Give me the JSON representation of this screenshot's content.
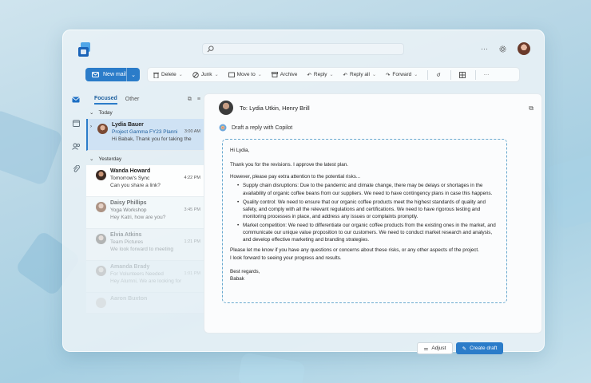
{
  "search": {
    "placeholder": ""
  },
  "header": {
    "more_label": "···"
  },
  "toolbar": {
    "new_mail": "New mail",
    "delete": "Delete",
    "junk": "Junk",
    "move_to": "Move to",
    "archive": "Archive",
    "reply": "Reply",
    "reply_all": "Reply all",
    "forward": "Forward",
    "more": "···"
  },
  "list": {
    "tab_focused": "Focused",
    "tab_other": "Other",
    "group_today": "Today",
    "group_yesterday": "Yesterday",
    "items": [
      {
        "name": "Lydia Bauer",
        "subject": "Project Gamma FY23 Planni",
        "time": "3:00 AM",
        "preview": "Hi Babak, Thank you for taking the"
      },
      {
        "name": "Wanda Howard",
        "subject": "Tomorrow's Sync",
        "time": "4:22 PM",
        "preview": "Can you share a link?"
      },
      {
        "name": "Daisy Phillips",
        "subject": "Yoga Workshop",
        "time": "3:45 PM",
        "preview": "Hey Katri, how are you?"
      },
      {
        "name": "Elvia Atkins",
        "subject": "Team Pictures",
        "time": "1:21 PM",
        "preview": "We look forward to meeting"
      },
      {
        "name": "Amanda Brady",
        "subject": "For Volunteers Needed",
        "time": "1:01 PM",
        "preview": "Hey Alumni, We are looking for"
      },
      {
        "name": "Aaron Buxton",
        "subject": "",
        "time": "",
        "preview": ""
      }
    ]
  },
  "reading": {
    "to_line": "To: Lydia Utkin, Henry Brill",
    "copilot_line": "Draft a reply with Copilot",
    "greeting": "Hi Lydia,",
    "p1": "Thank you for the revisions. I approve the latest plan.",
    "p2": "However, please pay extra attention to the potential risks...",
    "bullets": [
      "Supply chain disruptions: Due to the pandemic and climate change, there may be delays or shortages in the availability of organic coffee beans from our suppliers. We need to have contingency plans in case this happens.",
      "Quality control: We need to ensure that our organic coffee products meet the highest standards of quality and safety, and comply with all the relevant regulations and certifications. We need to have rigorous testing and monitoring processes in place, and address any issues or complaints promptly.",
      "Market competition: We need to differentiate our organic coffee products from the existing ones in the market, and communicate our unique value proposition to our customers. We need to conduct market research and analysis, and develop effective marketing and branding strategies."
    ],
    "p3": "Please let me know if you have any questions or concerns about these risks, or any other aspects of the project.",
    "p4": "I look forward to seeing your progress and results.",
    "closing": "Best regards,",
    "signature": "Babak",
    "adjust": "Adjust",
    "create_draft": "Create draft"
  },
  "colors": {
    "accent": "#2b7cc9",
    "selected_row": "#cfe2f4"
  }
}
